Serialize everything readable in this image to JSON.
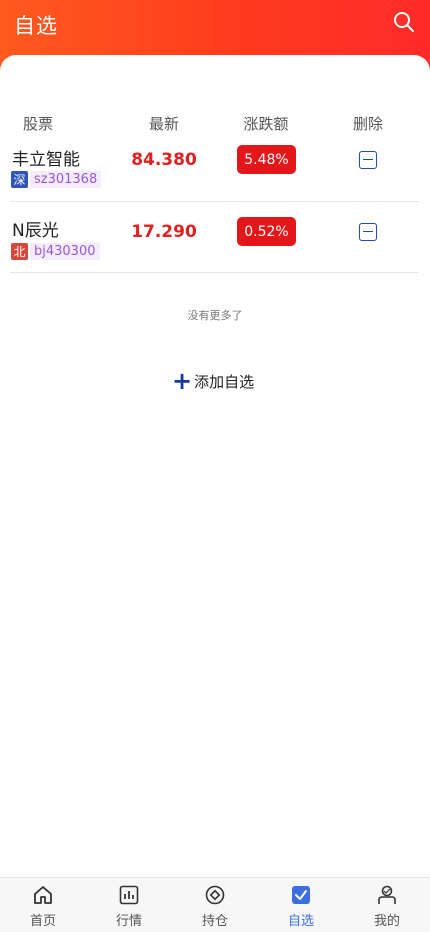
{
  "header": {
    "title": "自选"
  },
  "columns": {
    "stock": "股票",
    "latest": "最新",
    "change": "涨跌额",
    "delete": "删除"
  },
  "rows": [
    {
      "name": "丰立智能",
      "market": "深",
      "market_color": "#2f56b8",
      "code": "sz301368",
      "price": "84.380",
      "change": "5.48%"
    },
    {
      "name": "N辰光",
      "market": "北",
      "market_color": "#d9463a",
      "code": "bj430300",
      "price": "17.290",
      "change": "0.52%"
    }
  ],
  "list_footer": "没有更多了",
  "add_button": {
    "label": "添加自选"
  },
  "tabs": [
    {
      "label": "首页",
      "icon": "home-icon"
    },
    {
      "label": "行情",
      "icon": "chart-icon"
    },
    {
      "label": "持仓",
      "icon": "position-icon"
    },
    {
      "label": "自选",
      "icon": "watchlist-icon",
      "active": true
    },
    {
      "label": "我的",
      "icon": "user-icon"
    }
  ],
  "colors": {
    "header_start": "#ff5a1f",
    "header_end": "#ff2a2a",
    "up": "#e02020",
    "active_tab": "#3b6fe0",
    "delete": "#1f4ea8"
  }
}
